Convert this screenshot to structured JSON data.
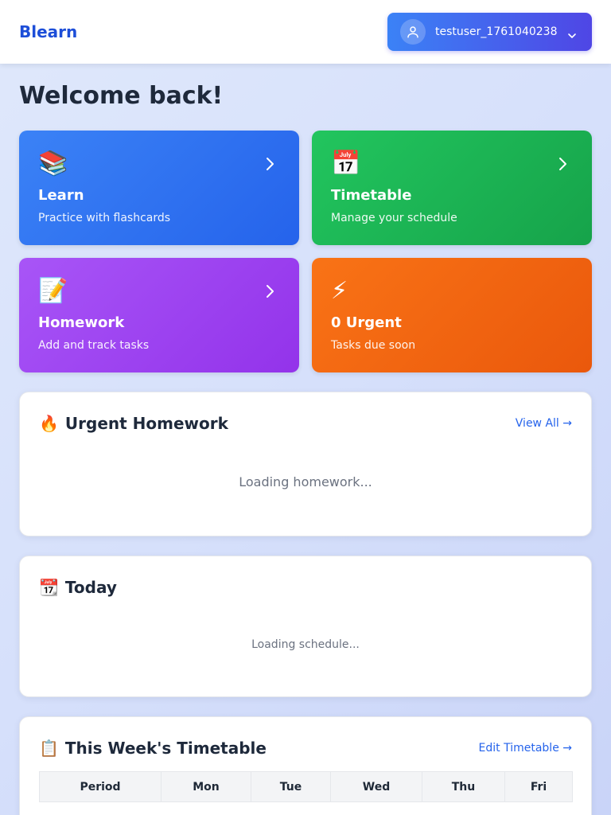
{
  "header": {
    "brand": "Blearn",
    "user": {
      "name": "testuser_1761040238",
      "avatar_icon": "user-icon",
      "menu_icon": "chevron-down-icon"
    }
  },
  "page": {
    "title": "Welcome back!"
  },
  "cards": {
    "learn": {
      "icon": "📚",
      "title": "Learn",
      "subtitle": "Practice with flashcards",
      "color": "#3b82f6"
    },
    "timetable": {
      "icon": "📅",
      "title": "Timetable",
      "subtitle": "Manage your schedule",
      "color": "#22c55e"
    },
    "homework": {
      "icon": "📝",
      "title": "Homework",
      "subtitle": "Add and track tasks",
      "color": "#a855f7"
    },
    "urgent": {
      "icon": "⚡",
      "title": "0 Urgent",
      "subtitle": "Tasks due soon",
      "color": "#f97316"
    }
  },
  "urgent_homework": {
    "icon": "🔥",
    "title": "Urgent Homework",
    "link": "View All →",
    "status": "Loading homework..."
  },
  "today": {
    "icon": "📆",
    "title": "Today",
    "status": "Loading schedule..."
  },
  "week_timetable": {
    "icon": "📋",
    "title": "This Week's Timetable",
    "link": "Edit Timetable →",
    "columns": [
      "Period",
      "Mon",
      "Tue",
      "Wed",
      "Thu",
      "Fri"
    ]
  },
  "colors": {
    "brand": "#1d4ed8",
    "link": "#2563eb",
    "accent_start": "#3b82f6",
    "accent_end": "#4f46e5"
  }
}
